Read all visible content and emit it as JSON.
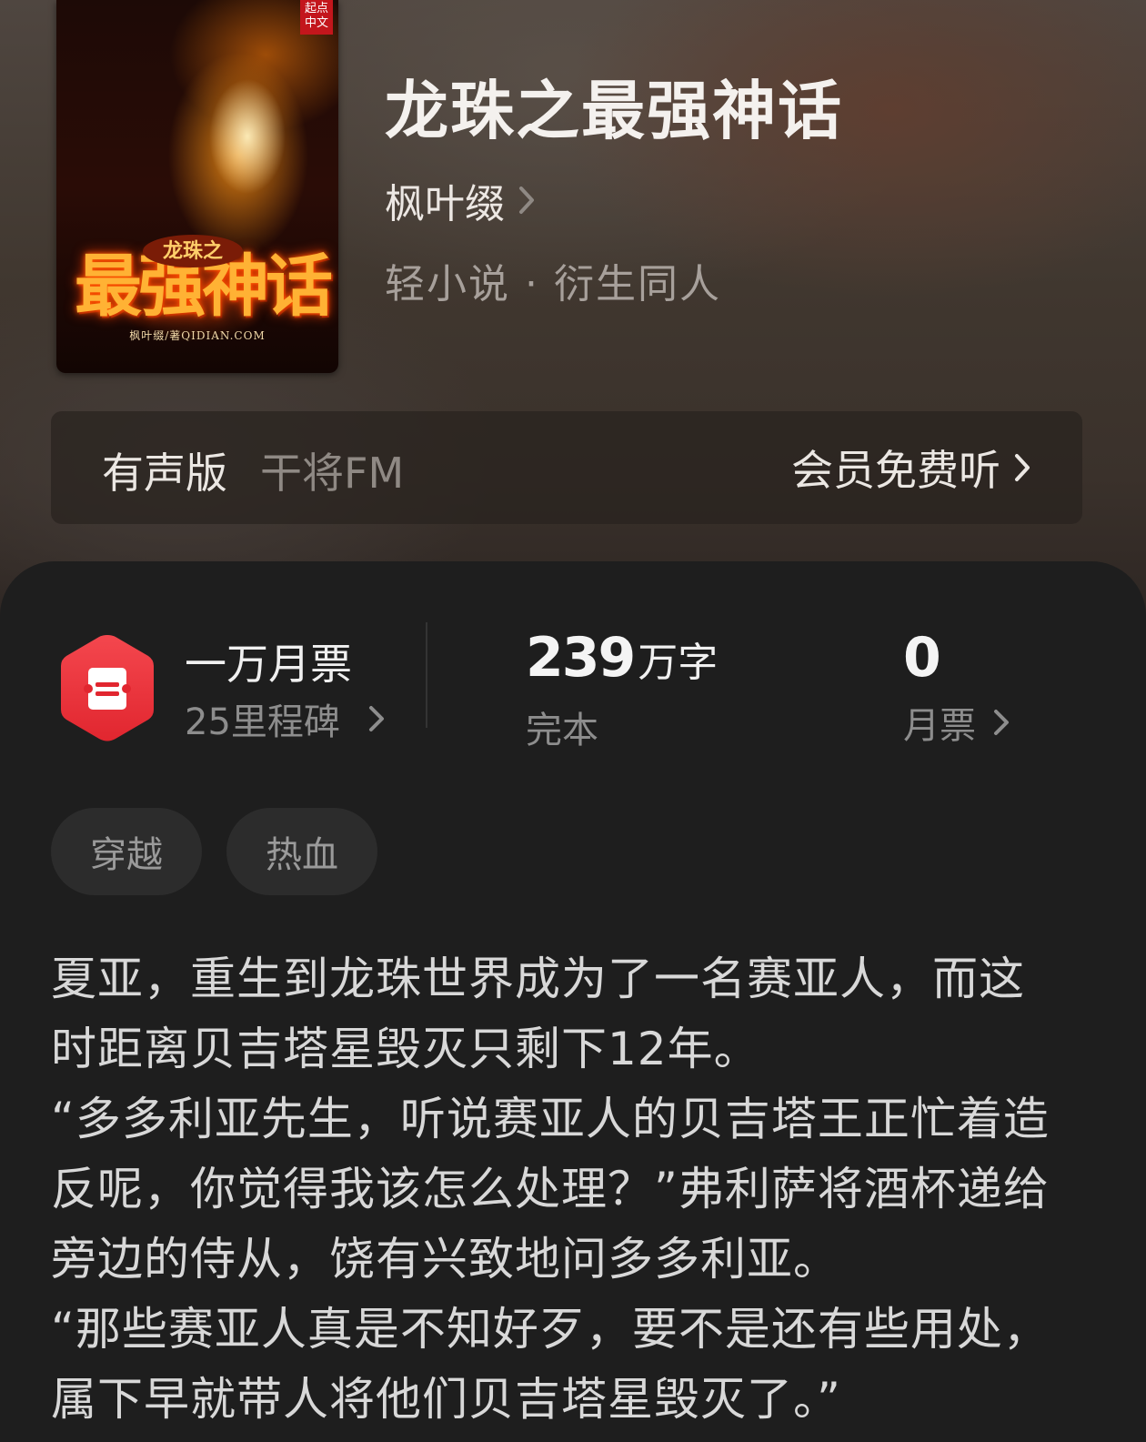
{
  "book": {
    "title": "龙珠之最强神话",
    "author": "枫叶缀",
    "category": "轻小说 · 衍生同人",
    "cover": {
      "publisher_logo": "起点中文",
      "subtitle": "龙珠之",
      "title": "最强神话",
      "credit": "枫叶缀/著QIDIAN.COM"
    }
  },
  "audio": {
    "label": "有声版",
    "platform": "干将FM",
    "cta": "会员免费听"
  },
  "stats": {
    "milestone_title": "一万月票",
    "milestone_sub": "25里程碑",
    "word_count": "239",
    "word_unit": "万字",
    "status": "完本",
    "monthly_votes": "0",
    "monthly_label": "月票"
  },
  "tags": [
    "穿越",
    "热血"
  ],
  "synopsis": [
    "夏亚，重生到龙珠世界成为了一名赛亚人，而这时距离贝吉塔星毁灭只剩下12年。",
    "“多多利亚先生，听说赛亚人的贝吉塔王正忙着造反呢，你觉得我该怎么处理？”弗利萨将酒杯递给旁边的侍从，饶有兴致地问多多利亚。",
    "“那些赛亚人真是不知好歹，要不是还有些用处，属下早就带人将他们贝吉塔星毁灭了。”"
  ],
  "colors": {
    "badge": "#ef3b43",
    "background": "#1e1e1e"
  }
}
